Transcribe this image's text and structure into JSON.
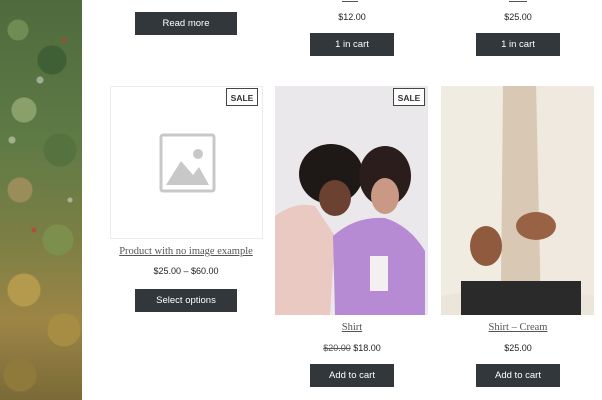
{
  "top_row": {
    "col1_button": "Read more",
    "col2_price": "$12.00",
    "col2_button": "1 in cart",
    "col3_price": "$25.00",
    "col3_button": "1 in cart"
  },
  "products": [
    {
      "title": "Product with no image example",
      "price_range": "$25.00 – $60.00",
      "button": "Select options",
      "sale_badge": "SALE"
    },
    {
      "title": "Shirt",
      "price_old": "$20.00",
      "price_new": "$18.00",
      "button": "Add to cart",
      "sale_badge": "SALE"
    },
    {
      "title": "Shirt – Cream",
      "price": "$25.00",
      "button": "Add to cart"
    }
  ],
  "icons": {
    "placeholder": "image-placeholder-icon"
  }
}
